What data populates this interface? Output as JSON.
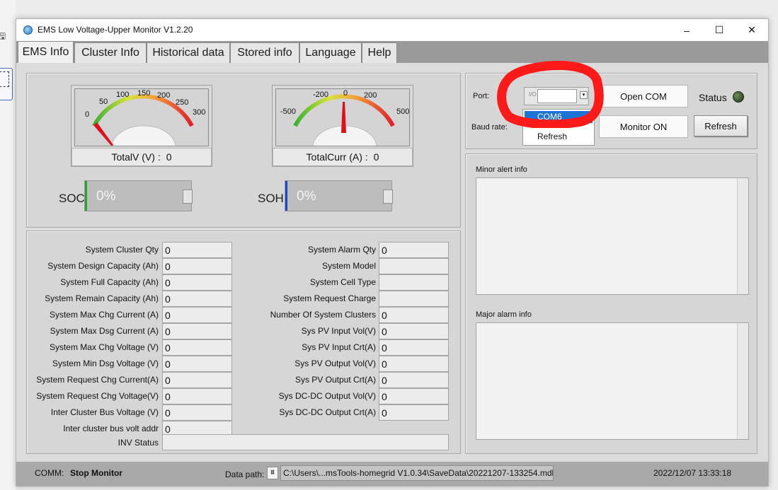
{
  "window": {
    "title": "EMS Low Voltage-Upper Monitor V1.2.20",
    "minimize": "–",
    "maximize": "☐",
    "close": "✕"
  },
  "tabs": [
    "EMS Info",
    "Cluster Info",
    "Historical data",
    "Stored info",
    "Language",
    "Help"
  ],
  "gauges": {
    "voltage": {
      "label": "TotalV (V) :",
      "value": "0",
      "ticks": [
        "0",
        "50",
        "100",
        "150",
        "200",
        "250",
        "300"
      ]
    },
    "current": {
      "label": "TotalCurr (A) :",
      "value": "0",
      "ticks": [
        "-500",
        "-200",
        "0",
        "200",
        "500"
      ]
    }
  },
  "bars": {
    "soc": {
      "label": "SOC",
      "value": "0%",
      "accent": "#22aa22"
    },
    "soh": {
      "label": "SOH",
      "value": "0%",
      "accent": "#2244cc"
    }
  },
  "fields_left": [
    {
      "label": "System Cluster Qty",
      "value": "0"
    },
    {
      "label": "System Design Capacity (Ah)",
      "value": "0"
    },
    {
      "label": "System Full Capacity (Ah)",
      "value": "0"
    },
    {
      "label": "System Remain Capacity (Ah)",
      "value": "0"
    },
    {
      "label": "System Max Chg Current (A)",
      "value": "0"
    },
    {
      "label": "System Max Dsg Current (A)",
      "value": "0"
    },
    {
      "label": "System Max Chg Voltage (V)",
      "value": "0"
    },
    {
      "label": "System Min Dsg Voltage (V)",
      "value": "0"
    },
    {
      "label": "System Request Chg Current(A)",
      "value": "0"
    },
    {
      "label": "System Request Chg Voltage(V)",
      "value": "0"
    },
    {
      "label": "Inter Cluster Bus Voltage  (V)",
      "value": "0"
    },
    {
      "label": "Inter cluster bus volt addr",
      "value": "0"
    }
  ],
  "fields_right": [
    {
      "label": "System Alarm Qty",
      "value": "0"
    },
    {
      "label": "System Model",
      "value": ""
    },
    {
      "label": "System Cell Type",
      "value": ""
    },
    {
      "label": "System Request Charge",
      "value": ""
    },
    {
      "label": "Number Of System Clusters",
      "value": "0"
    },
    {
      "label": "Sys PV Input Vol(V)",
      "value": "0"
    },
    {
      "label": "Sys PV Input Crt(A)",
      "value": "0"
    },
    {
      "label": "Sys PV Output Vol(V)",
      "value": "0"
    },
    {
      "label": "Sys PV Output Crt(A)",
      "value": "0"
    },
    {
      "label": "Sys DC-DC Output Vol(V)",
      "value": "0"
    },
    {
      "label": "Sys DC-DC Output Crt(A)",
      "value": "0"
    }
  ],
  "inv_status": {
    "label": "INV Status",
    "value": ""
  },
  "comm": {
    "port_label": "Port:",
    "port_prefix": "I/O",
    "baud_label": "Baud rate:",
    "dropdown_options": [
      "COM6",
      "Refresh"
    ],
    "open_com": "Open COM",
    "monitor_on": "Monitor ON",
    "refresh": "Refresh",
    "status_label": "Status"
  },
  "alerts": {
    "minor_label": "Minor alert info",
    "major_label": "Major alarm info"
  },
  "statusbar": {
    "comm_label": "COMM:",
    "comm_value": "Stop Monitor",
    "data_path_label": "Data path:",
    "data_path": "C:\\Users\\...msTools-homegrid V1.0.34\\SaveData\\20221207-133254.mdb",
    "datetime": "2022/12/07 13:33:18"
  },
  "colors": {
    "annotation_red": "#ff1a1a",
    "selection_blue": "#1e74d6"
  }
}
